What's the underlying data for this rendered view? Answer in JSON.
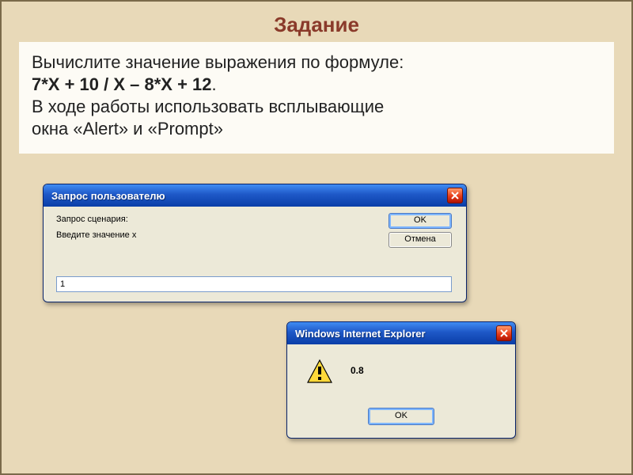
{
  "slide": {
    "title": "Задание",
    "task_line1": "Вычислите значение выражения по формуле:",
    "formula": "7*X + 10 / X – 8*X + 12",
    "formula_suffix": ".",
    "task_line2a": "В ходе работы использовать всплывающие",
    "task_line2b": "окна «Alert» и «Prompt»"
  },
  "prompt_dialog": {
    "title": "Запрос пользователю",
    "line1": "Запрос сценария:",
    "line2": "Введите значение x",
    "ok_label": "OK",
    "cancel_label": "Отмена",
    "input_value": "1"
  },
  "alert_dialog": {
    "title": "Windows Internet Explorer",
    "message": "0.8",
    "ok_label": "OK"
  }
}
